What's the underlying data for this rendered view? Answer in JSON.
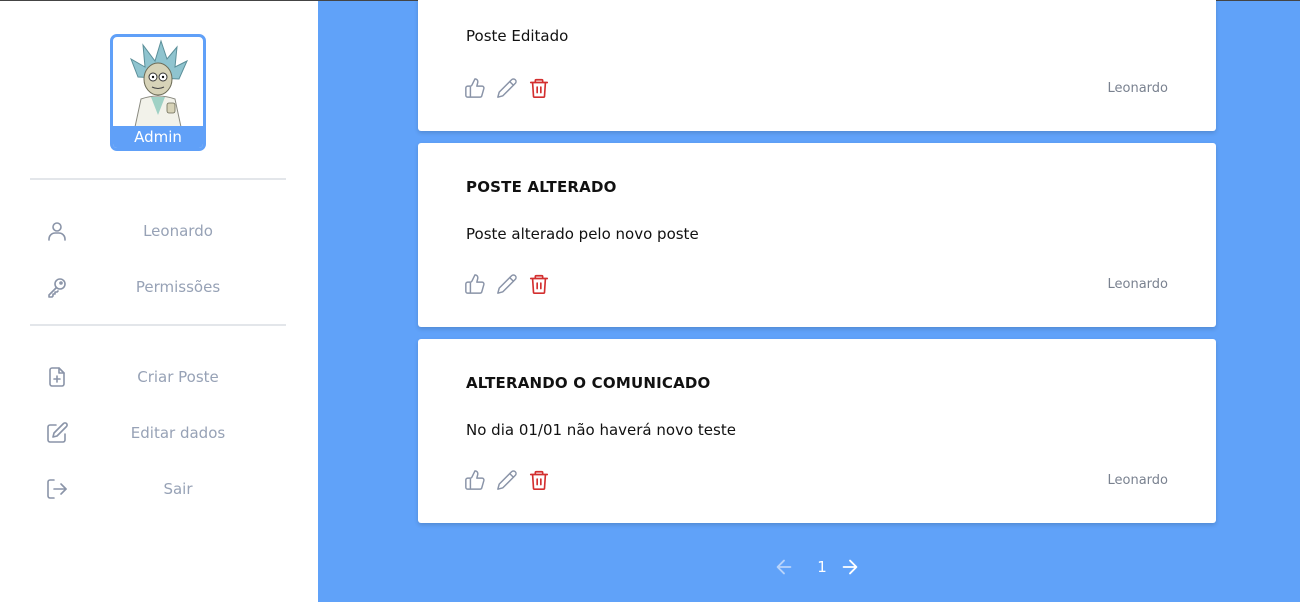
{
  "sidebar": {
    "avatar_label": "Admin",
    "items": [
      {
        "label": "Leonardo",
        "icon": "user-icon"
      },
      {
        "label": "Permissões",
        "icon": "key-icon"
      },
      {
        "label": "Criar Poste",
        "icon": "file-plus-icon"
      },
      {
        "label": "Editar dados",
        "icon": "edit-icon"
      },
      {
        "label": "Sair",
        "icon": "logout-icon"
      }
    ]
  },
  "posts": [
    {
      "title": "",
      "body": "Poste Editado",
      "author": "Leonardo"
    },
    {
      "title": "POSTE ALTERADO",
      "body": "Poste alterado pelo novo poste",
      "author": "Leonardo"
    },
    {
      "title": "ALTERANDO O COMUNICADO",
      "body": "No dia 01/01 não haverá novo teste",
      "author": "Leonardo"
    }
  ],
  "pagination": {
    "current_page": "1"
  },
  "colors": {
    "accent": "#60a2f9",
    "delete": "#d32f2f",
    "muted_text": "#97a2b6"
  }
}
